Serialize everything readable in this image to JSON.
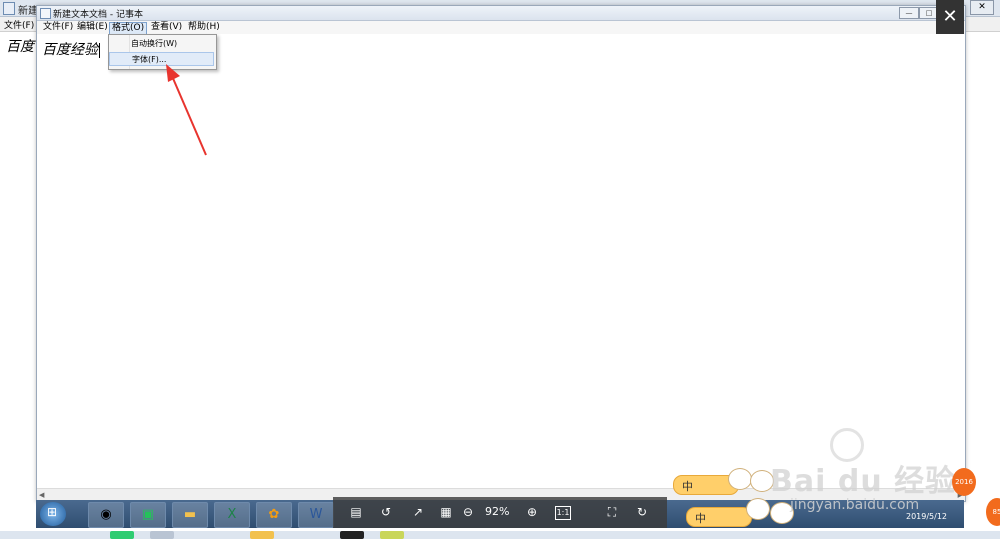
{
  "background_window": {
    "title": "新建",
    "menu_file": "文件(F)",
    "text": "百度",
    "close_glyph": "✕"
  },
  "foreground_window": {
    "title": "新建文本文档 - 记事本",
    "menus": [
      {
        "label": "文件(F)"
      },
      {
        "label": "编辑(E)"
      },
      {
        "label": "格式(O)"
      },
      {
        "label": "查看(V)"
      },
      {
        "label": "帮助(H)"
      }
    ],
    "active_menu": "格式(O)",
    "editor_text": "百度经验",
    "window_buttons": {
      "minimize": "—",
      "maximize": "□",
      "close": "✕"
    }
  },
  "format_menu": {
    "items": [
      {
        "label": "自动换行(W)"
      },
      {
        "label": "字体(F)..."
      }
    ]
  },
  "viewer": {
    "close_glyph": "✕",
    "zoom": "92%",
    "actual_size": "1:1"
  },
  "taskbar": {
    "clock_date": "2019/5/12"
  },
  "ime": {
    "label": "中"
  },
  "watermark": {
    "brand": "Bai du 经验",
    "url": "jingyan.baidu.com"
  },
  "side_badges": [
    "2016",
    "85"
  ],
  "colors": {
    "arrow": "#e8342e",
    "taskbar": "#3a5a80",
    "menu_highlight": "#dde9f7"
  },
  "icons": [
    "start-orb-icon",
    "browser-icon",
    "iqiyi-icon",
    "folder-icon",
    "excel-icon",
    "uc-browser-icon",
    "word-icon"
  ]
}
